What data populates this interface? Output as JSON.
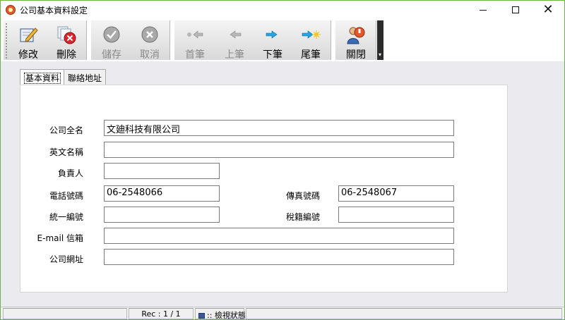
{
  "window": {
    "title": "公司基本資料設定",
    "controls": {
      "minimize": "—",
      "maximize": "☐",
      "close": "✕"
    }
  },
  "toolbar": {
    "buttons": [
      {
        "label": "修改",
        "icon": "edit-icon",
        "enabled": true
      },
      {
        "label": "刪除",
        "icon": "delete-icon",
        "enabled": true
      },
      {
        "label": "儲存",
        "icon": "save-check-icon",
        "enabled": false
      },
      {
        "label": "取消",
        "icon": "cancel-icon",
        "enabled": false
      },
      {
        "label": "首筆",
        "icon": "first-record-icon",
        "enabled": false
      },
      {
        "label": "上筆",
        "icon": "previous-record-icon",
        "enabled": false
      },
      {
        "label": "下筆",
        "icon": "next-record-icon",
        "enabled": true
      },
      {
        "label": "尾筆",
        "icon": "last-record-icon",
        "enabled": true
      },
      {
        "label": "關閉",
        "icon": "close-door-icon",
        "enabled": true
      }
    ],
    "overflow_glyph": "▾"
  },
  "tabs": [
    {
      "label": "基本資料",
      "active": true
    },
    {
      "label": "聯絡地址",
      "active": false
    }
  ],
  "form": {
    "company_name": {
      "label": "公司全名",
      "value": "文廸科技有限公司"
    },
    "english_name": {
      "label": "英文名稱",
      "value": ""
    },
    "owner": {
      "label": "負責人",
      "value": ""
    },
    "phone": {
      "label": "電話號碼",
      "value": "06-2548066"
    },
    "fax": {
      "label": "傳真號碼",
      "value": "06-2548067"
    },
    "tax_id": {
      "label": "統一編號",
      "value": ""
    },
    "tax_reg": {
      "label": "稅籍編號",
      "value": ""
    },
    "email": {
      "label": "E-mail 信箱",
      "value": ""
    },
    "website": {
      "label": "公司網址",
      "value": ""
    }
  },
  "status": {
    "record": "Rec : 1 / 1",
    "mode": ":: 檢視狀態"
  },
  "colors": {
    "window_border": "#6db34b",
    "background": "#eaeaef",
    "panel": "#ffffff"
  }
}
